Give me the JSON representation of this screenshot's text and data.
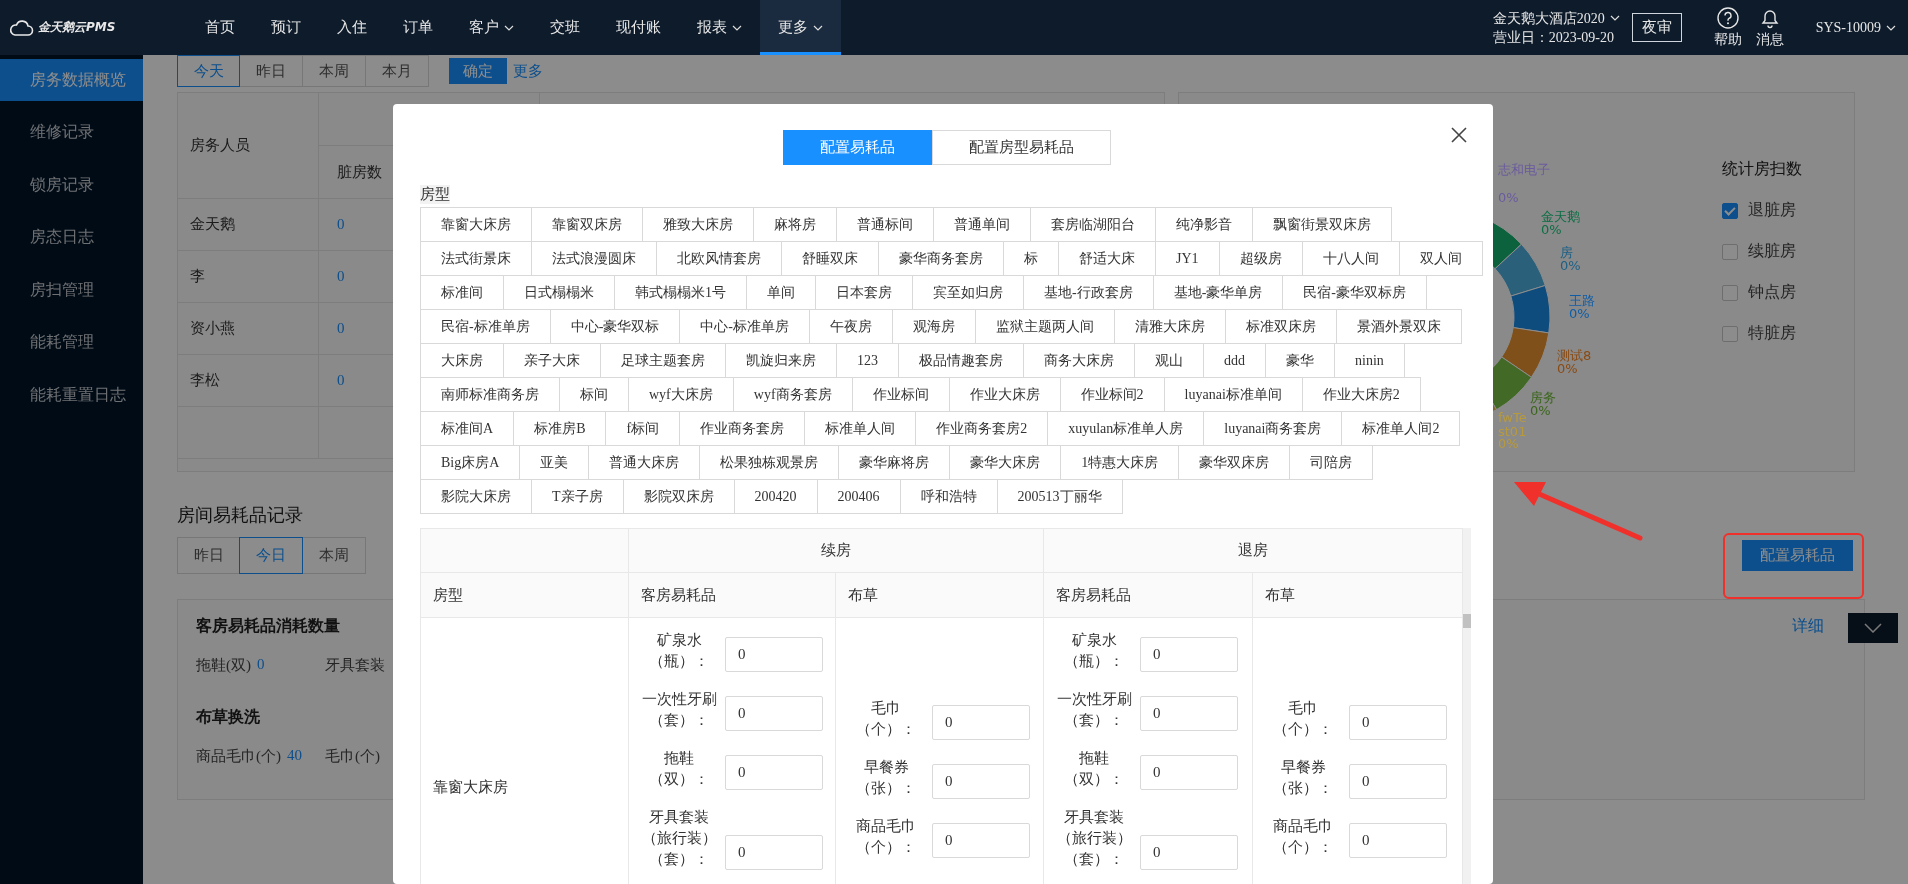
{
  "header": {
    "logo": "金天鹅云PMS",
    "nav": [
      {
        "label": "首页",
        "dropdown": false,
        "selected": false
      },
      {
        "label": "预订",
        "dropdown": false,
        "selected": false
      },
      {
        "label": "入住",
        "dropdown": false,
        "selected": false
      },
      {
        "label": "订单",
        "dropdown": false,
        "selected": false
      },
      {
        "label": "客户",
        "dropdown": true,
        "selected": false
      },
      {
        "label": "交班",
        "dropdown": false,
        "selected": false
      },
      {
        "label": "现付账",
        "dropdown": false,
        "selected": false
      },
      {
        "label": "报表",
        "dropdown": true,
        "selected": false
      },
      {
        "label": "更多",
        "dropdown": true,
        "selected": true
      }
    ],
    "hotel": "金天鹅大酒店2020",
    "business_day": "营业日：2023-09-20",
    "night_audit": "夜审",
    "help": "帮助",
    "messages": "消息",
    "user": "SYS-10009"
  },
  "sidebar": {
    "items": [
      {
        "label": "房务数据概览",
        "selected": true
      },
      {
        "label": "维修记录",
        "selected": false
      },
      {
        "label": "锁房记录",
        "selected": false
      },
      {
        "label": "房态日志",
        "selected": false
      },
      {
        "label": "房扫管理",
        "selected": false
      },
      {
        "label": "能耗管理",
        "selected": false
      },
      {
        "label": "能耗重置日志",
        "selected": false
      }
    ]
  },
  "overview": {
    "periods": [
      {
        "label": "今天",
        "selected": true
      },
      {
        "label": "昨日",
        "selected": false
      },
      {
        "label": "本周",
        "selected": false
      },
      {
        "label": "本月",
        "selected": false
      }
    ],
    "confirm": "确定",
    "more": "更多",
    "table": {
      "columns": [
        "房务人员",
        "脏房数"
      ],
      "rows": [
        [
          "金天鹅",
          "0"
        ],
        [
          "李",
          "0"
        ],
        [
          "资小燕",
          "0"
        ],
        [
          "李松",
          "0"
        ]
      ]
    }
  },
  "chart": {
    "labels": [
      {
        "name": "志和电子",
        "percent": "0%",
        "color": "#6b5b9e"
      },
      {
        "name": "金天鹅",
        "percent": "0%",
        "color": "#0e6e45"
      },
      {
        "name": "房",
        "percent": "0%",
        "color": "#1d5f85"
      },
      {
        "name": "王路",
        "percent": "0%",
        "color": "#0f5da6"
      },
      {
        "name": "测试8",
        "percent": "0%",
        "color": "#8a4a12"
      },
      {
        "name": "房务",
        "percent": "0%",
        "color": "#3b661c"
      },
      {
        "name": "fwTest01",
        "percent": "0%",
        "color": "#b89a3e"
      }
    ]
  },
  "stats": {
    "title": "统计房扫数",
    "options": [
      {
        "label": "退脏房",
        "checked": true
      },
      {
        "label": "续脏房",
        "checked": false
      },
      {
        "label": "钟点房",
        "checked": false
      },
      {
        "label": "特脏房",
        "checked": false
      }
    ]
  },
  "consumables": {
    "title": "房间易耗品记录",
    "periods": [
      {
        "label": "昨日",
        "selected": false
      },
      {
        "label": "今日",
        "selected": true
      },
      {
        "label": "本周",
        "selected": false
      }
    ],
    "configure": "配置易耗品",
    "details": "详细",
    "usage_title": "客房易耗品消耗数量",
    "usage": [
      {
        "name": "拖鞋(双)",
        "value": "0"
      },
      {
        "name": "牙具套装"
      }
    ],
    "linen_title": "布草换洗",
    "linen": [
      {
        "name": "商品毛巾(个)",
        "value": "40"
      },
      {
        "name": "毛巾(个)"
      }
    ]
  },
  "modal": {
    "tabs": [
      {
        "label": "配置易耗品",
        "selected": true
      },
      {
        "label": "配置房型易耗品",
        "selected": false
      }
    ],
    "room_type_label": "房型",
    "room_types": [
      [
        "靠窗大床房",
        "靠窗双床房",
        "雅致大床房",
        "麻将房",
        "普通标间",
        "普通单间",
        "套房临湖阳台",
        "纯净影音",
        "飘窗街景双床房"
      ],
      [
        "法式街景床",
        "法式浪漫圆床",
        "北欧风情套房",
        "舒睡双床",
        "豪华商务套房",
        "标",
        "舒适大床",
        "JY1",
        "超级房",
        "十八人间",
        "双人间"
      ],
      [
        "标准间",
        "日式榻榻米",
        "韩式榻榻米1号",
        "单间",
        "日本套房",
        "宾至如归房",
        "基地-行政套房",
        "基地-豪华单房",
        "民宿-豪华双标房"
      ],
      [
        "民宿-标准单房",
        "中心-豪华双标",
        "中心-标准单房",
        "午夜房",
        "观海房",
        "监狱主题两人间",
        "清雅大床房",
        "标准双床房",
        "景酒外景双床"
      ],
      [
        "大床房",
        "亲子大床",
        "足球主题套房",
        "凯旋归来房",
        "123",
        "极品情趣套房",
        "商务大床房",
        "观山",
        "ddd",
        "豪华",
        "ninin"
      ],
      [
        "南师标准商务房",
        "标间",
        "wyf大床房",
        "wyf商务套房",
        "作业标间",
        "作业大床房",
        "作业标间2",
        "luyanai标准单间",
        "作业大床房2"
      ],
      [
        "标准间A",
        "标准房B",
        "f标间",
        "作业商务套房",
        "标准单人间",
        "作业商务套房2",
        "xuyulan标准单人房",
        "luyanai商务套房",
        "标准单人间2"
      ],
      [
        "Big床房A",
        "亚美",
        "普通大床房",
        "松果独栋观景房",
        "豪华麻将房",
        "豪华大床房",
        "1特惠大床房",
        "豪华双床房",
        "司陪房"
      ],
      [
        "影院大床房",
        "T亲子房",
        "影院双床房",
        "200420",
        "200406",
        "呼和浩特",
        "200513丁丽华"
      ]
    ],
    "table": {
      "groups": [
        "续房",
        "退房"
      ],
      "columns": [
        "房型",
        "客房易耗品",
        "布草",
        "客房易耗品",
        "布草"
      ],
      "rows": [
        {
          "cells": [
            {
              "text": "靠窗大床房"
            },
            {
              "fields": [
                {
                  "label": [
                    "矿泉水",
                    "（瓶）："
                  ],
                  "value": "0"
                },
                {
                  "label": [
                    "一次性牙刷",
                    "（套）："
                  ],
                  "value": "0"
                },
                {
                  "label": [
                    "拖鞋",
                    "（双）："
                  ],
                  "value": "0"
                },
                {
                  "label": [
                    "牙具套装",
                    "（旅行装）",
                    "（套）："
                  ],
                  "value": "0"
                }
              ]
            },
            {
              "fields": [
                {
                  "label": [
                    "毛巾",
                    "（个）："
                  ],
                  "value": "0"
                },
                {
                  "label": [
                    "早餐券",
                    "（张）："
                  ],
                  "value": "0"
                },
                {
                  "label": [
                    "商品毛巾",
                    "（个）："
                  ],
                  "value": "0"
                }
              ]
            },
            {
              "fields": [
                {
                  "label": [
                    "矿泉水",
                    "（瓶）："
                  ],
                  "value": "0"
                },
                {
                  "label": [
                    "一次性牙刷",
                    "（套）："
                  ],
                  "value": "0"
                },
                {
                  "label": [
                    "拖鞋",
                    "（双）："
                  ],
                  "value": "0"
                },
                {
                  "label": [
                    "牙具套装",
                    "（旅行装）",
                    "（套）："
                  ],
                  "value": "0"
                }
              ]
            },
            {
              "fields": [
                {
                  "label": [
                    "毛巾",
                    "（个）："
                  ],
                  "value": "0"
                },
                {
                  "label": [
                    "早餐券",
                    "（张）："
                  ],
                  "value": "0"
                },
                {
                  "label": [
                    "商品毛巾",
                    "（个）："
                  ],
                  "value": "0"
                }
              ]
            }
          ]
        }
      ]
    }
  }
}
